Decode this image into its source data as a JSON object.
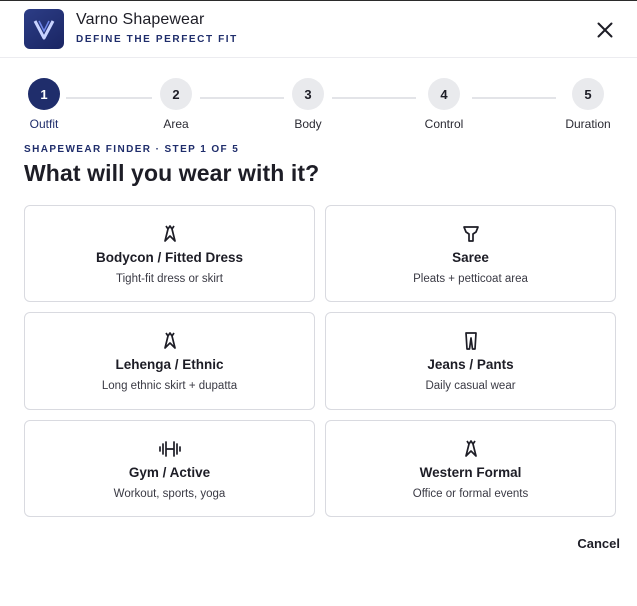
{
  "header": {
    "brand_name": "Varno Shapewear",
    "tagline": "DEFINE THE PERFECT FIT",
    "logo_letter": "V",
    "close_icon": "close-icon"
  },
  "steps": [
    {
      "number": "1",
      "label": "Outfit",
      "active": true
    },
    {
      "number": "2",
      "label": "Area",
      "active": false
    },
    {
      "number": "3",
      "label": "Body",
      "active": false
    },
    {
      "number": "4",
      "label": "Control",
      "active": false
    },
    {
      "number": "5",
      "label": "Duration",
      "active": false
    }
  ],
  "main": {
    "eyebrow": "SHAPEWEAR FINDER · STEP 1 OF 5",
    "question": "What will you wear with it?"
  },
  "options": [
    {
      "icon": "dress-icon",
      "title": "Bodycon / Fitted Dress",
      "subtitle": "Tight-fit dress or skirt"
    },
    {
      "icon": "saree-icon",
      "title": "Saree",
      "subtitle": "Pleats + petticoat area"
    },
    {
      "icon": "dress-icon",
      "title": "Lehenga / Ethnic",
      "subtitle": "Long ethnic skirt + dupatta"
    },
    {
      "icon": "pants-icon",
      "title": "Jeans / Pants",
      "subtitle": "Daily casual wear"
    },
    {
      "icon": "dumbbell-icon",
      "title": "Gym / Active",
      "subtitle": "Workout, sports, yoga"
    },
    {
      "icon": "dress-icon",
      "title": "Western Formal",
      "subtitle": "Office or formal events"
    }
  ],
  "footer": {
    "cancel_label": "Cancel"
  },
  "colors": {
    "accent": "#1f2d6b",
    "step_inactive": "#e9eaed",
    "border": "#d9dae0"
  }
}
